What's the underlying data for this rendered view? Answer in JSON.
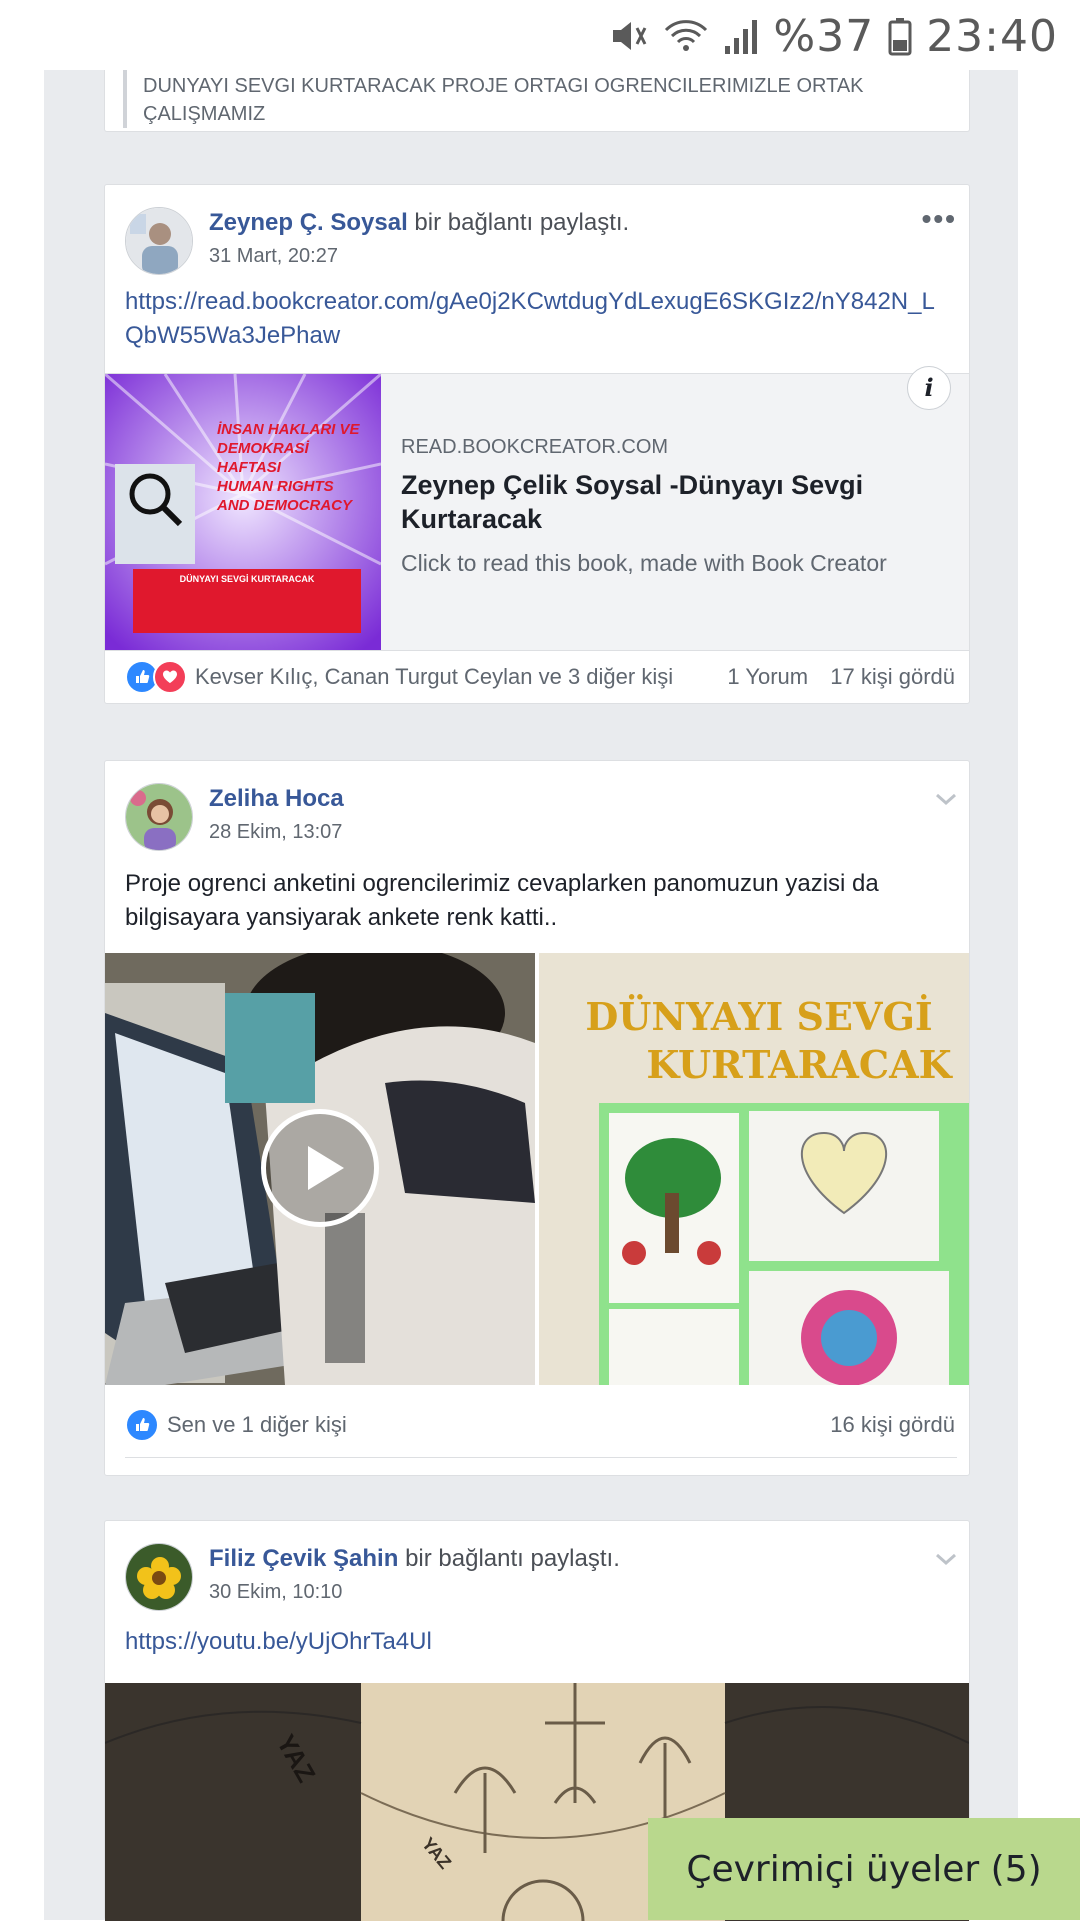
{
  "status_bar": {
    "battery": "%37",
    "time": "23:40"
  },
  "top_card": {
    "quote": "DUNYAYI SEVGI KURTARACAK PROJE ORTAGI OGRENCILERIMIZLE ORTAK ÇALIŞMAMIZ"
  },
  "posts": [
    {
      "author": "Zeynep Ç. Soysal",
      "action": "bir bağlantı paylaştı.",
      "time": "31 Mart, 20:27",
      "text": "https://read.bookcreator.com/gAe0j2KCwtdugYdLexugE6SKGIz2/nY842N_LQbW55Wa3JePhaw",
      "link_preview": {
        "domain": "READ.BOOKCREATOR.COM",
        "title": "Zeynep Çelik Soysal -Dünyayı Sevgi Kurtaracak",
        "description": "Click to read this book, made with Book Creator",
        "thumbnail_text": [
          "İNSAN HAKLARI VE",
          "DEMOKRASİ",
          "HAFTASI",
          "HUMAN RIGHTS",
          "AND DEMOCRACY"
        ],
        "thumbnail_caption": "DÜNYAYI SEVGİ KURTARACAK"
      },
      "reactions": {
        "names": "Kevser Kılıç, Canan Turgut Ceylan ve 3 diğer kişi",
        "comments": "1 Yorum",
        "views": "17 kişi gördü"
      }
    },
    {
      "author": "Zeliha Hoca",
      "action": "",
      "time": "28 Ekim, 13:07",
      "text": "Proje ogrenci anketini ogrencilerimiz cevaplarken panomuzun yazisi da bilgisayara yansiyarak ankete renk katti..",
      "photo_right_text": [
        "DÜNYAYI SEVGİ",
        "KURTARACAK"
      ],
      "reactions": {
        "names": "Sen ve 1 diğer kişi",
        "views": "16 kişi gördü"
      }
    },
    {
      "author": "Filiz Çevik Şahin",
      "action": "bir bağlantı paylaştı.",
      "time": "30 Ekim, 10:10",
      "text": "https://youtu.be/yUjOhrTa4Ul",
      "thumbnail_words": [
        "YAZ",
        "YAZ"
      ]
    }
  ],
  "chat": {
    "label": "Çevrimiçi üyeler (5)"
  },
  "colors": {
    "link": "#385898",
    "page_bg": "#e9ebee",
    "chat_bg": "#b9d88d",
    "like": "#2d88ff",
    "love": "#f33e58"
  }
}
